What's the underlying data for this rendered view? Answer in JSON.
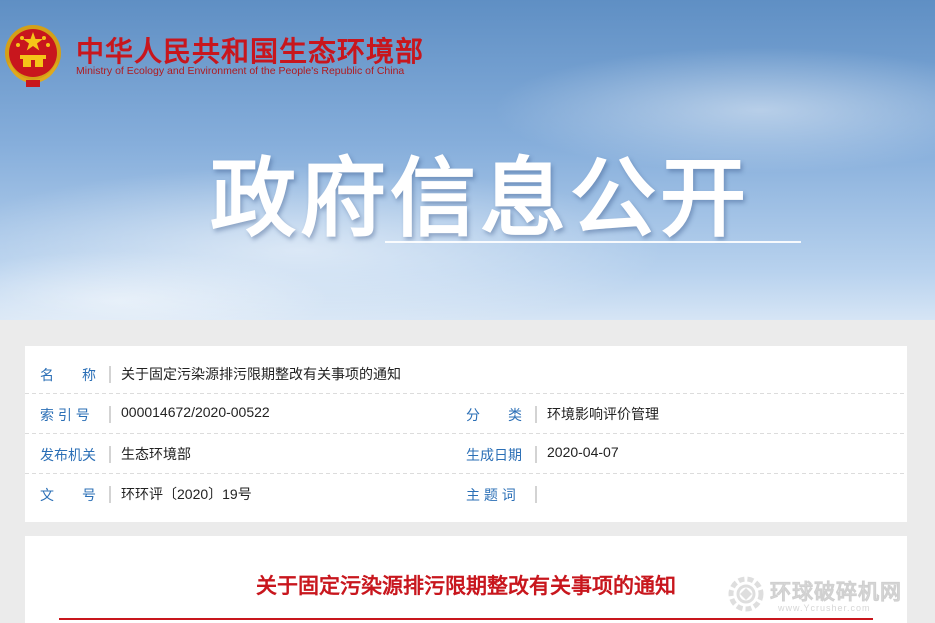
{
  "header": {
    "ministry_cn": "中华人民共和国生态环境部",
    "ministry_en": "Ministry of Ecology and Environment of the People's Republic of China",
    "emblem_icon": "national-emblem-icon",
    "hero_title": "政府信息公开"
  },
  "meta": {
    "name_label": "名　　称",
    "name_value": "关于固定污染源排污限期整改有关事项的通知",
    "index_label": "索 引 号",
    "index_value": "000014672/2020-00522",
    "category_label": "分　　类",
    "category_value": "环境影响评价管理",
    "issuer_label": "发布机关",
    "issuer_value": "生态环境部",
    "date_label": "生成日期",
    "date_value": "2020-04-07",
    "docno_label": "文　　号",
    "docno_value": "环环评〔2020〕19号",
    "keywords_label": "主 题 词",
    "keywords_value": ""
  },
  "document": {
    "title": "关于固定污染源排污限期整改有关事项的通知"
  },
  "watermark": {
    "text": "环球破碎机网",
    "url": "www.Ycrusher.com",
    "icon": "gear-logo-icon"
  },
  "colors": {
    "brand_red": "#c8161d",
    "label_blue": "#2b6fb6"
  }
}
